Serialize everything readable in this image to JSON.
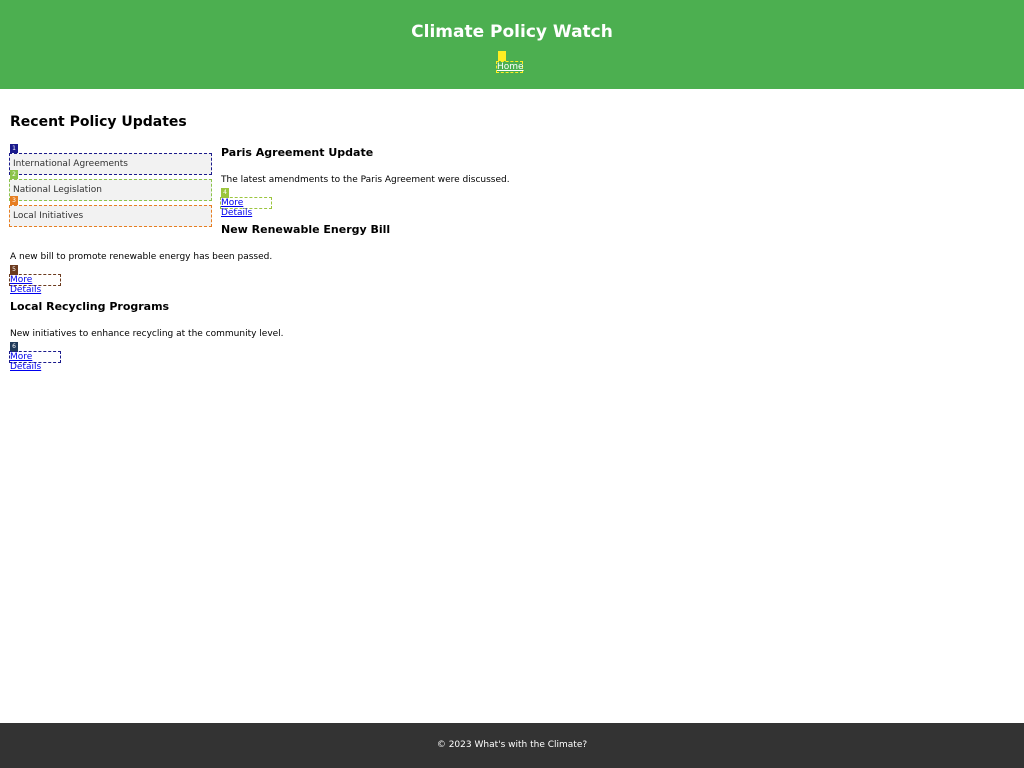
{
  "header": {
    "title": "Climate Policy Watch",
    "nav": {
      "home_label": "Home"
    }
  },
  "main": {
    "section_title": "Recent Policy Updates",
    "categories": [
      {
        "label": "International Agreements"
      },
      {
        "label": "National Legislation"
      },
      {
        "label": "Local Initiatives"
      }
    ],
    "posts": [
      {
        "title": "Paris Agreement Update",
        "text": "The latest amendments to the Paris Agreement were discussed.",
        "link_label": "More Details"
      },
      {
        "title": "New Renewable Energy Bill",
        "text": "A new bill to promote renewable energy has been passed.",
        "link_label": "More Details"
      },
      {
        "title": "Local Recycling Programs",
        "text": "New initiatives to enhance recycling at the community level.",
        "link_label": "More Details"
      }
    ]
  },
  "markers": [
    "1",
    "2",
    "3",
    "4",
    "5",
    "6"
  ],
  "footer": {
    "text": "© 2023 What's with the Climate?"
  },
  "colors": {
    "header_bg": "#4caf50",
    "footer_bg": "#333333",
    "link": "#0000ee",
    "category_bg": "#f2f2f2"
  }
}
